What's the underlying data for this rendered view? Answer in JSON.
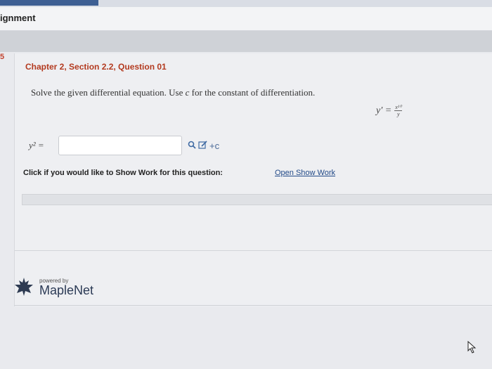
{
  "header": {
    "title": "ignment",
    "side_number": "5"
  },
  "question": {
    "title": "Chapter 2, Section 2.2, Question 01",
    "instruction_before": "Solve the given differential equation. Use ",
    "instruction_var": "c",
    "instruction_after": " for the constant of differentiation.",
    "equation_lhs": "y′ =",
    "equation_num": "x¹⁰",
    "equation_den": "y",
    "answer_label": "y² =",
    "answer_value": "",
    "tools_plus_c": "+c"
  },
  "show_work": {
    "prompt": "Click if you would like to Show Work for this question:",
    "link": "Open Show Work"
  },
  "footer": {
    "powered_by": "powered by",
    "brand": "MapleNet"
  },
  "colors": {
    "title_red": "#b33a1f",
    "link_blue": "#224a88",
    "tab_blue": "#3d5f93"
  }
}
